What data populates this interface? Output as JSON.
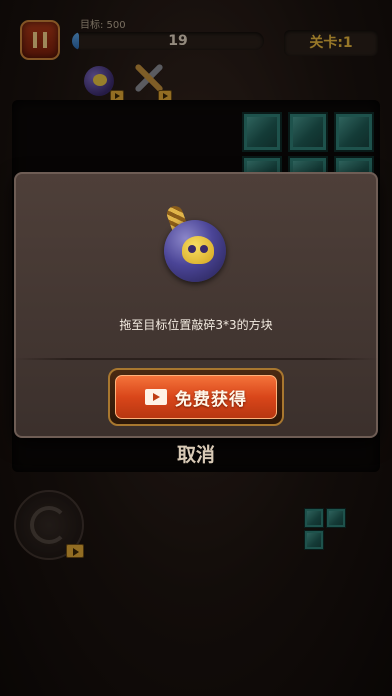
{
  "hud": {
    "pause_icon": "pause-icon",
    "target_label": "目标: 500",
    "score": "19",
    "progress_fraction": 0.038,
    "level_label": "关卡:1"
  },
  "tools": [
    {
      "name": "bomb",
      "icon": "bomb-icon",
      "badge": "video-icon"
    },
    {
      "name": "hammer",
      "icon": "hammer-icon",
      "badge": "video-icon"
    }
  ],
  "modal": {
    "item_icon": "bomb-icon",
    "description": "拖至目标位置敲碎3*3的方块",
    "free_button_label": "免费获得",
    "free_button_icon": "video-icon",
    "cancel_label": "取消"
  },
  "colors": {
    "tile": "#2f7e76",
    "button_orange": "#d9461a",
    "level_text": "#e8b73e",
    "progress_blue": "#3a7fc4"
  }
}
